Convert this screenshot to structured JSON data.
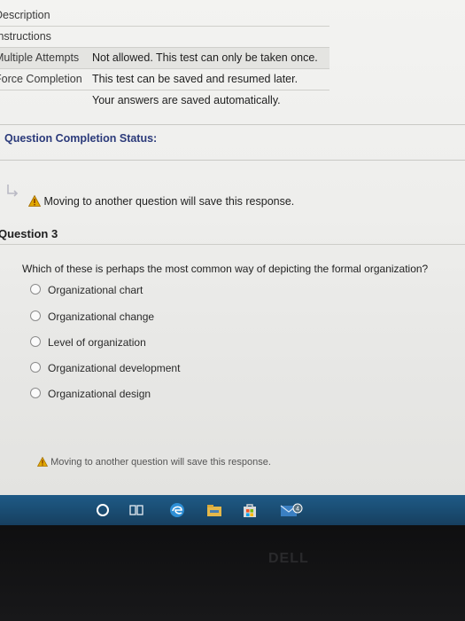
{
  "test_info": [
    {
      "label": "Description",
      "value": ""
    },
    {
      "label": "Instructions",
      "value": ""
    },
    {
      "label": "Multiple Attempts",
      "value": "Not allowed. This test can only be taken once."
    },
    {
      "label": "Force Completion",
      "value": "This test can be saved and resumed later."
    },
    {
      "label": "",
      "value": "Your answers are saved automatically."
    }
  ],
  "status": {
    "label": "Question Completion Status:"
  },
  "warning_top": "Moving to another question will save this response.",
  "question": {
    "title": "Question 3",
    "text": "Which of these is perhaps the most common way of depicting the formal organization?",
    "options": [
      "Organizational chart",
      "Organizational change",
      "Level of organization",
      "Organizational development",
      "Organizational design"
    ]
  },
  "warning_bottom": "Moving to another question will save this response.",
  "taskbar": {
    "icons": [
      "cortana-circle-icon",
      "task-view-icon",
      "edge-icon",
      "file-explorer-icon",
      "store-icon",
      "mail-icon"
    ],
    "mail_badge": "4",
    "color": "#1b4d74"
  },
  "bezel_logo": "DELL",
  "colors": {
    "status_text": "#2b3a7a",
    "warning_icon": "#e0a800"
  }
}
